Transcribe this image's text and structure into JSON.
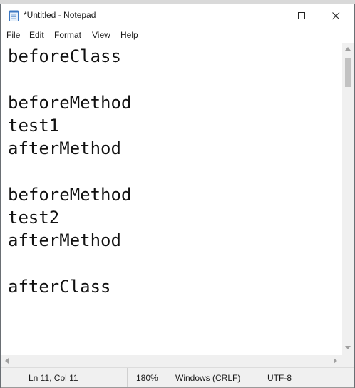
{
  "window": {
    "title": "*Untitled - Notepad"
  },
  "menu": [
    "File",
    "Edit",
    "Format",
    "View",
    "Help"
  ],
  "editor": {
    "text": "beforeClass\n\nbeforeMethod\ntest1\nafterMethod\n\nbeforeMethod\ntest2\nafterMethod\n\nafterClass"
  },
  "status": {
    "position": "Ln 11, Col 11",
    "zoom": "180%",
    "line_ending": "Windows (CRLF)",
    "encoding": "UTF-8"
  },
  "icons": {
    "app": "notepad-icon",
    "minimize": "minimize-icon",
    "maximize": "maximize-icon",
    "close": "close-icon"
  }
}
